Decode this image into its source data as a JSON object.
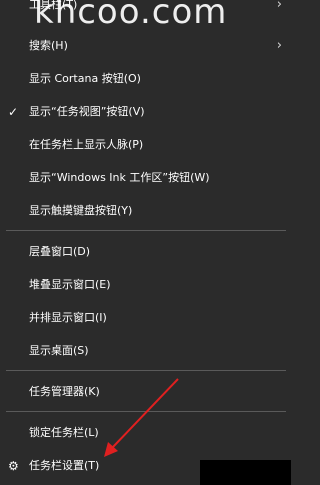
{
  "watermark": "khcoo.com",
  "menu": {
    "items": [
      {
        "label": "工具栏(T)",
        "checked": false,
        "submenu": true
      },
      {
        "label": "搜索(H)",
        "checked": false,
        "submenu": true
      },
      {
        "label": "显示 Cortana 按钮(O)",
        "checked": false,
        "submenu": false
      },
      {
        "label": "显示“任务视图”按钮(V)",
        "checked": true,
        "submenu": false
      },
      {
        "label": "在任务栏上显示人脉(P)",
        "checked": false,
        "submenu": false
      },
      {
        "label": "显示“Windows Ink 工作区”按钮(W)",
        "checked": false,
        "submenu": false
      },
      {
        "label": "显示触摸键盘按钮(Y)",
        "checked": false,
        "submenu": false
      },
      {
        "label": "层叠窗口(D)",
        "checked": false,
        "submenu": false
      },
      {
        "label": "堆叠显示窗口(E)",
        "checked": false,
        "submenu": false
      },
      {
        "label": "并排显示窗口(I)",
        "checked": false,
        "submenu": false
      },
      {
        "label": "显示桌面(S)",
        "checked": false,
        "submenu": false
      },
      {
        "label": "任务管理器(K)",
        "checked": false,
        "submenu": false
      },
      {
        "label": "锁定任务栏(L)",
        "checked": false,
        "submenu": false
      },
      {
        "label": "任务栏设置(T)",
        "checked": false,
        "submenu": false,
        "icon": "gear-icon"
      }
    ]
  },
  "icons": {
    "check": "✓",
    "chevron": "›",
    "gear": "⚙"
  },
  "colors": {
    "menu_background": "#2b2b2b",
    "text": "#ffffff",
    "separator": "#5a5a5a",
    "annotation_arrow": "#e02020"
  }
}
